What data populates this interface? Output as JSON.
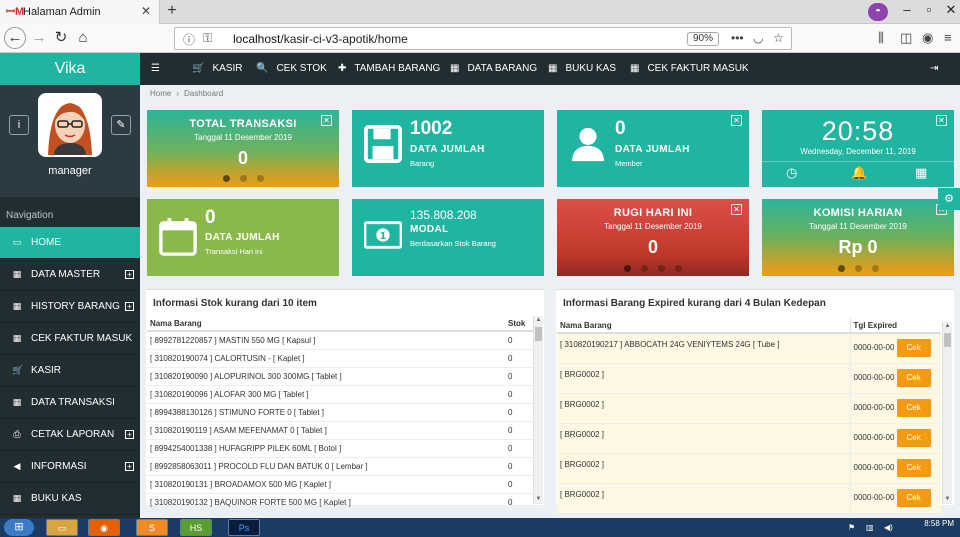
{
  "browser": {
    "tab_title": "Halaman Admin",
    "url_host": "localhost",
    "url_path": "/kasir-ci-v3-apotik/home",
    "zoom": "90%"
  },
  "sidebar": {
    "brand": "Vika",
    "username": "manager",
    "nav_header": "Navigation",
    "items": [
      {
        "label": "HOME",
        "icon": "desktop-icon",
        "expandable": false,
        "active": true
      },
      {
        "label": "DATA MASTER",
        "icon": "grid-icon",
        "expandable": true,
        "active": false
      },
      {
        "label": "HISTORY BARANG",
        "icon": "grid-icon",
        "expandable": true,
        "active": false
      },
      {
        "label": "CEK FAKTUR MASUK",
        "icon": "grid-icon",
        "expandable": false,
        "active": false
      },
      {
        "label": "KASIR",
        "icon": "cart-icon",
        "expandable": false,
        "active": false
      },
      {
        "label": "DATA TRANSAKSI",
        "icon": "grid-icon",
        "expandable": false,
        "active": false
      },
      {
        "label": "CETAK LAPORAN",
        "icon": "print-icon",
        "expandable": true,
        "active": false
      },
      {
        "label": "INFORMASI",
        "icon": "bullhorn-icon",
        "expandable": true,
        "active": false
      },
      {
        "label": "BUKU KAS",
        "icon": "grid-icon",
        "expandable": false,
        "active": false
      }
    ]
  },
  "topnav": [
    {
      "label": "KASIR",
      "icon": "cart-icon"
    },
    {
      "label": "CEK STOK",
      "icon": "search-icon"
    },
    {
      "label": "TAMBAH BARANG",
      "icon": "plus-icon"
    },
    {
      "label": "DATA BARANG",
      "icon": "grid-icon"
    },
    {
      "label": "BUKU KAS",
      "icon": "grid-icon"
    },
    {
      "label": "CEK FAKTUR MASUK",
      "icon": "grid-icon"
    }
  ],
  "breadcrumb": [
    "Home",
    "Dashboard"
  ],
  "cards": {
    "total_transaksi": {
      "title": "TOTAL TRANSAKSI",
      "date": "Tanggal 11 Desember 2019",
      "value": "0"
    },
    "data_barang": {
      "value": "1002",
      "label": "DATA JUMLAH",
      "sub": "Barang"
    },
    "data_member": {
      "value": "0",
      "label": "DATA JUMLAH",
      "sub": "Member"
    },
    "clock": {
      "time": "20:58",
      "date": "Wednesday, December 11, 2019"
    },
    "transaksi_hari_ini": {
      "value": "0",
      "label": "DATA JUMLAH",
      "sub": "Transaksi Hari ini"
    },
    "modal": {
      "value": "135.808.208",
      "label": "MODAL",
      "sub": "Berdasarkan Stok Barang"
    },
    "rugi": {
      "title": "RUGI HARI INI",
      "date": "Tanggal 11 Desember 2019",
      "value": "0"
    },
    "komisi": {
      "title": "KOMISI HARIAN",
      "date": "Tanggal 11 Desember 2019",
      "value": "Rp 0"
    }
  },
  "stock_panel": {
    "title": "Informasi Stok kurang dari 10 item",
    "columns": [
      "Nama Barang",
      "Stok"
    ],
    "rows": [
      [
        "[ 8992781220857 ] MASTIN 550 MG [ Kapsul ]",
        "0"
      ],
      [
        "[ 310820190074 ] CALORTUSIN - [ Kaplet ]",
        "0"
      ],
      [
        "[ 310820190090 ] ALOPURINOL 300 300MG [ Tablet ]",
        "0"
      ],
      [
        "[ 310820190096 ] ALOFAR 300 MG [ Tablet ]",
        "0"
      ],
      [
        "[ 8994388130126 ] STIMUNO FORTE 0 [ Tablet ]",
        "0"
      ],
      [
        "[ 310820190119 ] ASAM MEFENAMAT 0 [ Tablet ]",
        "0"
      ],
      [
        "[ 8994254001338 ] HUFAGRIPP PILEK 60ML [ Botol ]",
        "0"
      ],
      [
        "[ 8992858063011 ] PROCOLD FLU DAN BATUK 0 [ Lembar ]",
        "0"
      ],
      [
        "[ 310820190131 ] BROADAMOX 500 MG [ Kaplet ]",
        "0"
      ],
      [
        "[ 310820190132 ] BAQUINOR FORTE 500 MG [ Kaplet ]",
        "0"
      ]
    ]
  },
  "expired_panel": {
    "title": "Informasi Barang Expired kurang dari 4 Bulan Kedepan",
    "columns": [
      "Nama Barang",
      "Tgl Expired"
    ],
    "button_label": "Cek",
    "rows": [
      [
        "[ 310820190217 ] ABBOCATH 24G VENIYTEMS 24G [ Tube ]",
        "0000-00-00"
      ],
      [
        "[ BRG0002 ]",
        "0000-00-00"
      ],
      [
        "[ BRG0002 ]",
        "0000-00-00"
      ],
      [
        "[ BRG0002 ]",
        "0000-00-00"
      ],
      [
        "[ BRG0002 ]",
        "0000-00-00"
      ],
      [
        "[ BRG0002 ]",
        "0000-00-00"
      ]
    ]
  },
  "taskbar": {
    "time": "8:58 PM"
  },
  "colors": {
    "teal": "#1fb5a0",
    "dark": "#222d32",
    "green": "#8bb84a",
    "red": "#d64541",
    "orange": "#f39c12"
  }
}
